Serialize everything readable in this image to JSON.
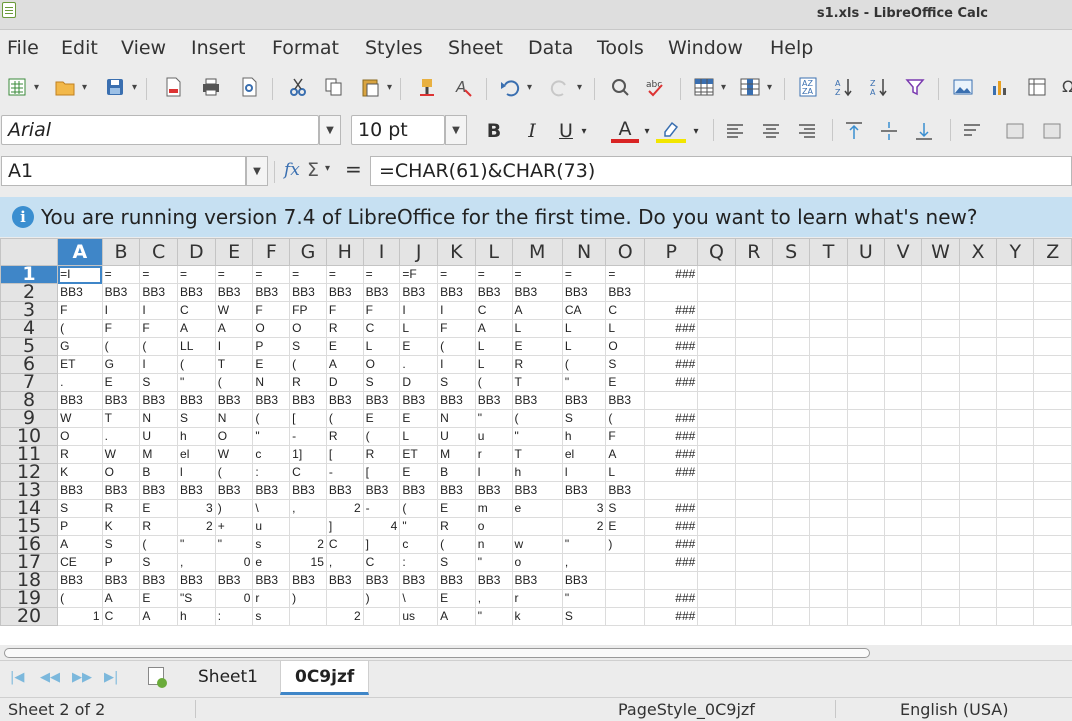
{
  "window": {
    "title": "s1.xls - LibreOffice Calc"
  },
  "menu": [
    "File",
    "Edit",
    "View",
    "Insert",
    "Format",
    "Styles",
    "Sheet",
    "Data",
    "Tools",
    "Window",
    "Help"
  ],
  "format_bar": {
    "font_name": "Arial",
    "font_size": "10 pt",
    "bold": "B",
    "italic": "I",
    "underline": "U",
    "font_color": "A"
  },
  "formula_bar": {
    "cell_ref": "A1",
    "formula": "=CHAR(61)&CHAR(73)",
    "fx": "fx",
    "sigma": "Σ",
    "equals": "="
  },
  "infobar": {
    "message": "You are running version 7.4 of LibreOffice for the first time. Do you want to learn what's new?"
  },
  "grid": {
    "columns": [
      "A",
      "B",
      "C",
      "D",
      "E",
      "F",
      "G",
      "H",
      "I",
      "J",
      "K",
      "L",
      "M",
      "N",
      "O",
      "P",
      "Q",
      "R",
      "S",
      "T",
      "U",
      "V",
      "W",
      "X",
      "Y",
      "Z"
    ],
    "active_column": "A",
    "active_row": "1",
    "rows": [
      {
        "n": "1",
        "cells": [
          "=I",
          "=",
          "=",
          "=",
          "=",
          "=",
          "=",
          "=",
          "=",
          "=F",
          "=",
          "=",
          "=",
          "=",
          "=",
          "###"
        ]
      },
      {
        "n": "2",
        "cells": [
          "BB3",
          "BB3",
          "BB3",
          "BB3",
          "BB3",
          "BB3",
          "BB3",
          "BB3",
          "BB3",
          "BB3",
          "BB3",
          "BB3",
          "BB3",
          "BB3",
          "BB3",
          ""
        ]
      },
      {
        "n": "3",
        "cells": [
          "F",
          "I",
          "I",
          "C",
          "W",
          "F",
          "FP",
          "F",
          "F",
          "I",
          "I",
          "C",
          "A",
          "CA",
          "C",
          "###"
        ]
      },
      {
        "n": "4",
        "cells": [
          "(",
          "F",
          "F",
          "A",
          "A",
          "O",
          "O",
          "R",
          "C",
          "L",
          "F",
          "A",
          "L",
          "L",
          "L",
          "###"
        ]
      },
      {
        "n": "5",
        "cells": [
          "G",
          "(",
          "(",
          "LL",
          "I",
          "P",
          "S",
          "E",
          "L",
          "E",
          "(",
          "L",
          "E",
          "L",
          "O",
          "###"
        ]
      },
      {
        "n": "6",
        "cells": [
          "ET",
          "G",
          "I",
          "(",
          "T",
          "E",
          "(",
          "A",
          "O",
          ".",
          "I",
          "L",
          "R",
          "(",
          "S",
          "###"
        ]
      },
      {
        "n": "7",
        "cells": [
          ".",
          "E",
          "S",
          "\"",
          "(",
          "N",
          "R",
          "D",
          "S",
          "D",
          "S",
          "(",
          "T",
          "\"",
          "E",
          "###"
        ]
      },
      {
        "n": "8",
        "cells": [
          "BB3",
          "BB3",
          "BB3",
          "BB3",
          "BB3",
          "BB3",
          "BB3",
          "BB3",
          "BB3",
          "BB3",
          "BB3",
          "BB3",
          "BB3",
          "BB3",
          "BB3",
          ""
        ]
      },
      {
        "n": "9",
        "cells": [
          "W",
          "T",
          "N",
          "S",
          "N",
          "(",
          "[",
          "(",
          "E",
          "E",
          "N",
          "\"",
          "(",
          "S",
          "(",
          "###"
        ]
      },
      {
        "n": "10",
        "cells": [
          "O",
          ".",
          "U",
          "h",
          "O",
          "\"",
          "-",
          "R",
          "(",
          "L",
          "U",
          "u",
          "\"",
          "h",
          "F",
          "###"
        ]
      },
      {
        "n": "11",
        "cells": [
          "R",
          "W",
          "M",
          "el",
          "W",
          "c",
          "1]",
          "[",
          "R",
          "ET",
          "M",
          "r",
          "T",
          "el",
          "A",
          "###"
        ]
      },
      {
        "n": "12",
        "cells": [
          "K",
          "O",
          "B",
          "l",
          "(",
          ":",
          "C",
          "-",
          "[",
          "E",
          "B",
          "l",
          "h",
          "l",
          "L",
          "###"
        ]
      },
      {
        "n": "13",
        "cells": [
          "BB3",
          "BB3",
          "BB3",
          "BB3",
          "BB3",
          "BB3",
          "BB3",
          "BB3",
          "BB3",
          "BB3",
          "BB3",
          "BB3",
          "BB3",
          "BB3",
          "BB3",
          ""
        ]
      },
      {
        "n": "14",
        "cells": [
          "S",
          "R",
          "E",
          "3",
          ")",
          "\\",
          ",",
          "2",
          "-",
          "(",
          "E",
          "m",
          "e",
          "3",
          "S",
          "###"
        ]
      },
      {
        "n": "15",
        "cells": [
          "P",
          "K",
          "R",
          "2",
          "+",
          "u",
          "",
          "]",
          "4",
          "\"",
          "R",
          "o",
          "",
          "2",
          "E",
          "###"
        ]
      },
      {
        "n": "16",
        "cells": [
          "A",
          "S",
          "(",
          "\"",
          "\"",
          "s",
          "2",
          "C",
          "]",
          "c",
          "(",
          "n",
          "w",
          "\"",
          ")",
          "###"
        ]
      },
      {
        "n": "17",
        "cells": [
          "CE",
          "P",
          "S",
          ",",
          "0",
          "e",
          "15",
          ",",
          "C",
          ":",
          "S",
          "\"",
          "o",
          ",",
          "",
          "###"
        ]
      },
      {
        "n": "18",
        "cells": [
          "BB3",
          "BB3",
          "BB3",
          "BB3",
          "BB3",
          "BB3",
          "BB3",
          "BB3",
          "BB3",
          "BB3",
          "BB3",
          "BB3",
          "BB3",
          "BB3",
          "",
          ""
        ]
      },
      {
        "n": "19",
        "cells": [
          "(",
          "A",
          "E",
          "\"S",
          "0",
          "r",
          ")",
          "",
          ")",
          "\\",
          "E",
          ",",
          "r",
          "\"",
          "",
          "###"
        ]
      },
      {
        "n": "20",
        "cells": [
          "1",
          "C",
          "A",
          "h",
          ":",
          "s",
          "",
          "2",
          "",
          "us",
          "A",
          "\"",
          "k",
          "S",
          "",
          "###"
        ]
      }
    ]
  },
  "tabs": {
    "items": [
      "Sheet1",
      "0C9jzf"
    ],
    "active": "0C9jzf"
  },
  "status": {
    "sheet": "Sheet 2 of 2",
    "page_style": "PageStyle_0C9jzf",
    "language": "English (USA)"
  },
  "colors": {
    "accent": "#3f86c8",
    "infobar": "#c6e0f2",
    "selection_header": "#3f86c8"
  }
}
